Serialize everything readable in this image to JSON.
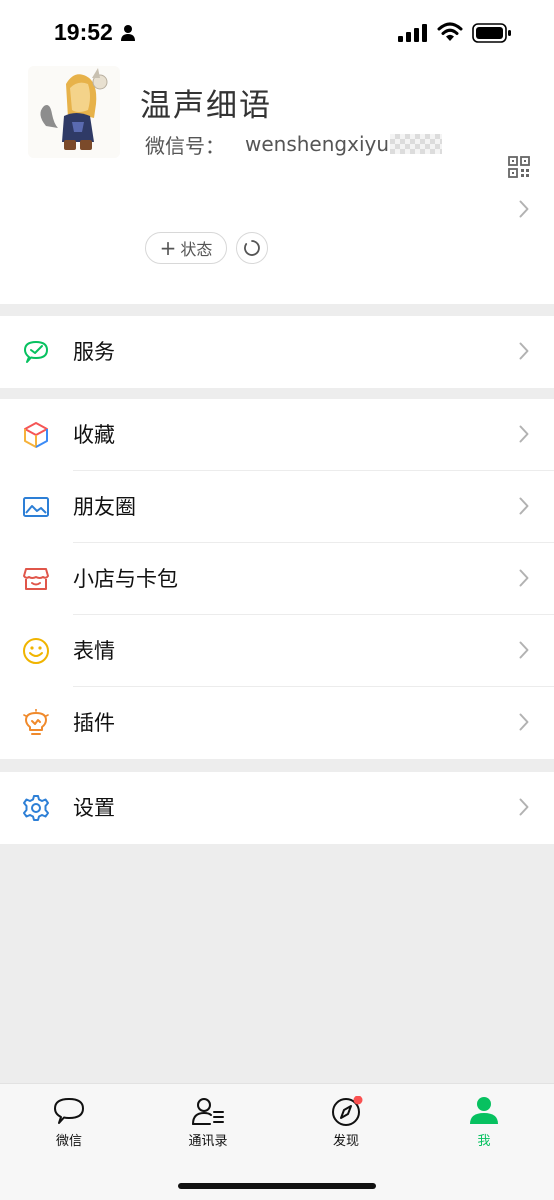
{
  "status_bar": {
    "time": "19:52"
  },
  "profile": {
    "name": "温声细语",
    "wechat_id_label": "微信号：",
    "wechat_id_value": "wenshengxiyu",
    "status_button_label": "状态"
  },
  "menu_groups": [
    {
      "items": [
        {
          "label": "服务",
          "icon": "service-icon"
        }
      ]
    },
    {
      "items": [
        {
          "label": "收藏",
          "icon": "favorites-icon"
        },
        {
          "label": "朋友圈",
          "icon": "moments-icon"
        },
        {
          "label": "小店与卡包",
          "icon": "shop-card-icon"
        },
        {
          "label": "表情",
          "icon": "sticker-icon"
        },
        {
          "label": "插件",
          "icon": "plugin-icon"
        }
      ]
    },
    {
      "items": [
        {
          "label": "设置",
          "icon": "settings-icon"
        }
      ]
    }
  ],
  "tab_bar": {
    "tabs": [
      {
        "label": "微信",
        "icon": "chat-bubble-icon"
      },
      {
        "label": "通讯录",
        "icon": "contacts-icon"
      },
      {
        "label": "发现",
        "icon": "compass-icon",
        "badge": "red-dot"
      },
      {
        "label": "我",
        "icon": "me-icon",
        "active": true
      }
    ]
  },
  "colors": {
    "accent": "#07c160",
    "badge": "#fa5151",
    "background": "#ededed"
  }
}
